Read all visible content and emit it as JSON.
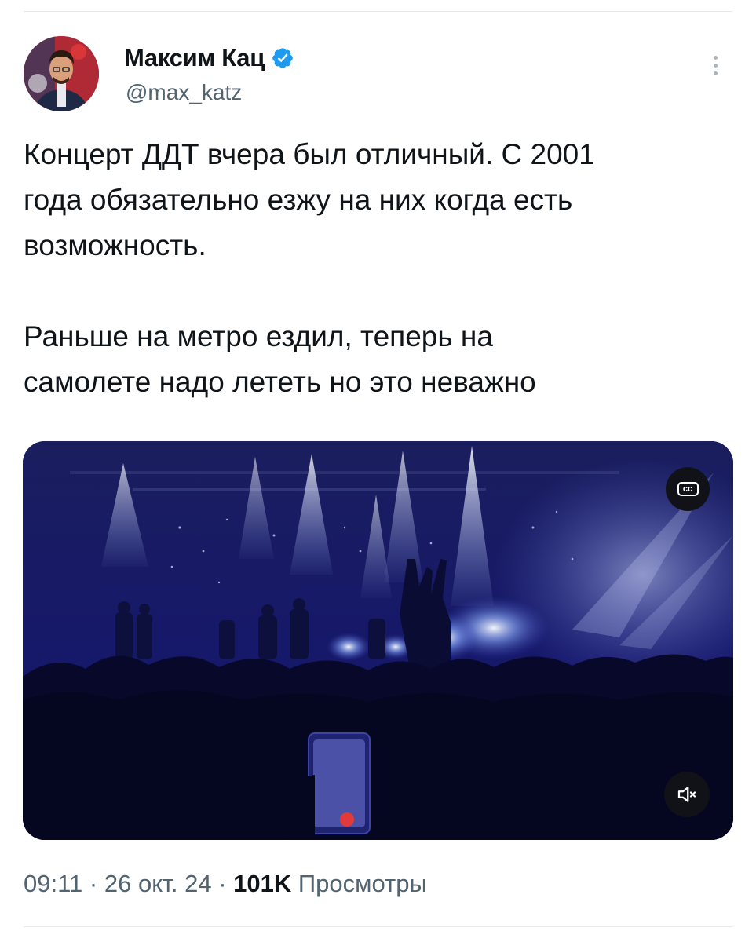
{
  "author": {
    "name": "Максим Кац",
    "handle": "@max_katz",
    "verified": true
  },
  "tweet": {
    "paragraphs": [
      "Концерт ДДТ вчера был отличный. С 2001\nгода обязательно езжу на них когда есть\nвозможность.",
      "Раньше на метро ездил, теперь на\nсамолете надо лететь но это неважно"
    ]
  },
  "media": {
    "type": "video",
    "cc_label": "cc"
  },
  "meta": {
    "time": "09:11",
    "separator": "·",
    "date": "26 окт. 24",
    "views_count": "101K",
    "views_label": "Просмотры"
  },
  "colors": {
    "text": "#0f1419",
    "secondary": "#536471",
    "verified": "#1d9bf0",
    "divider": "#e6e9ec"
  },
  "icons": [
    "verified-badge-icon",
    "more-options-icon",
    "closed-captions-icon",
    "volume-muted-icon"
  ]
}
